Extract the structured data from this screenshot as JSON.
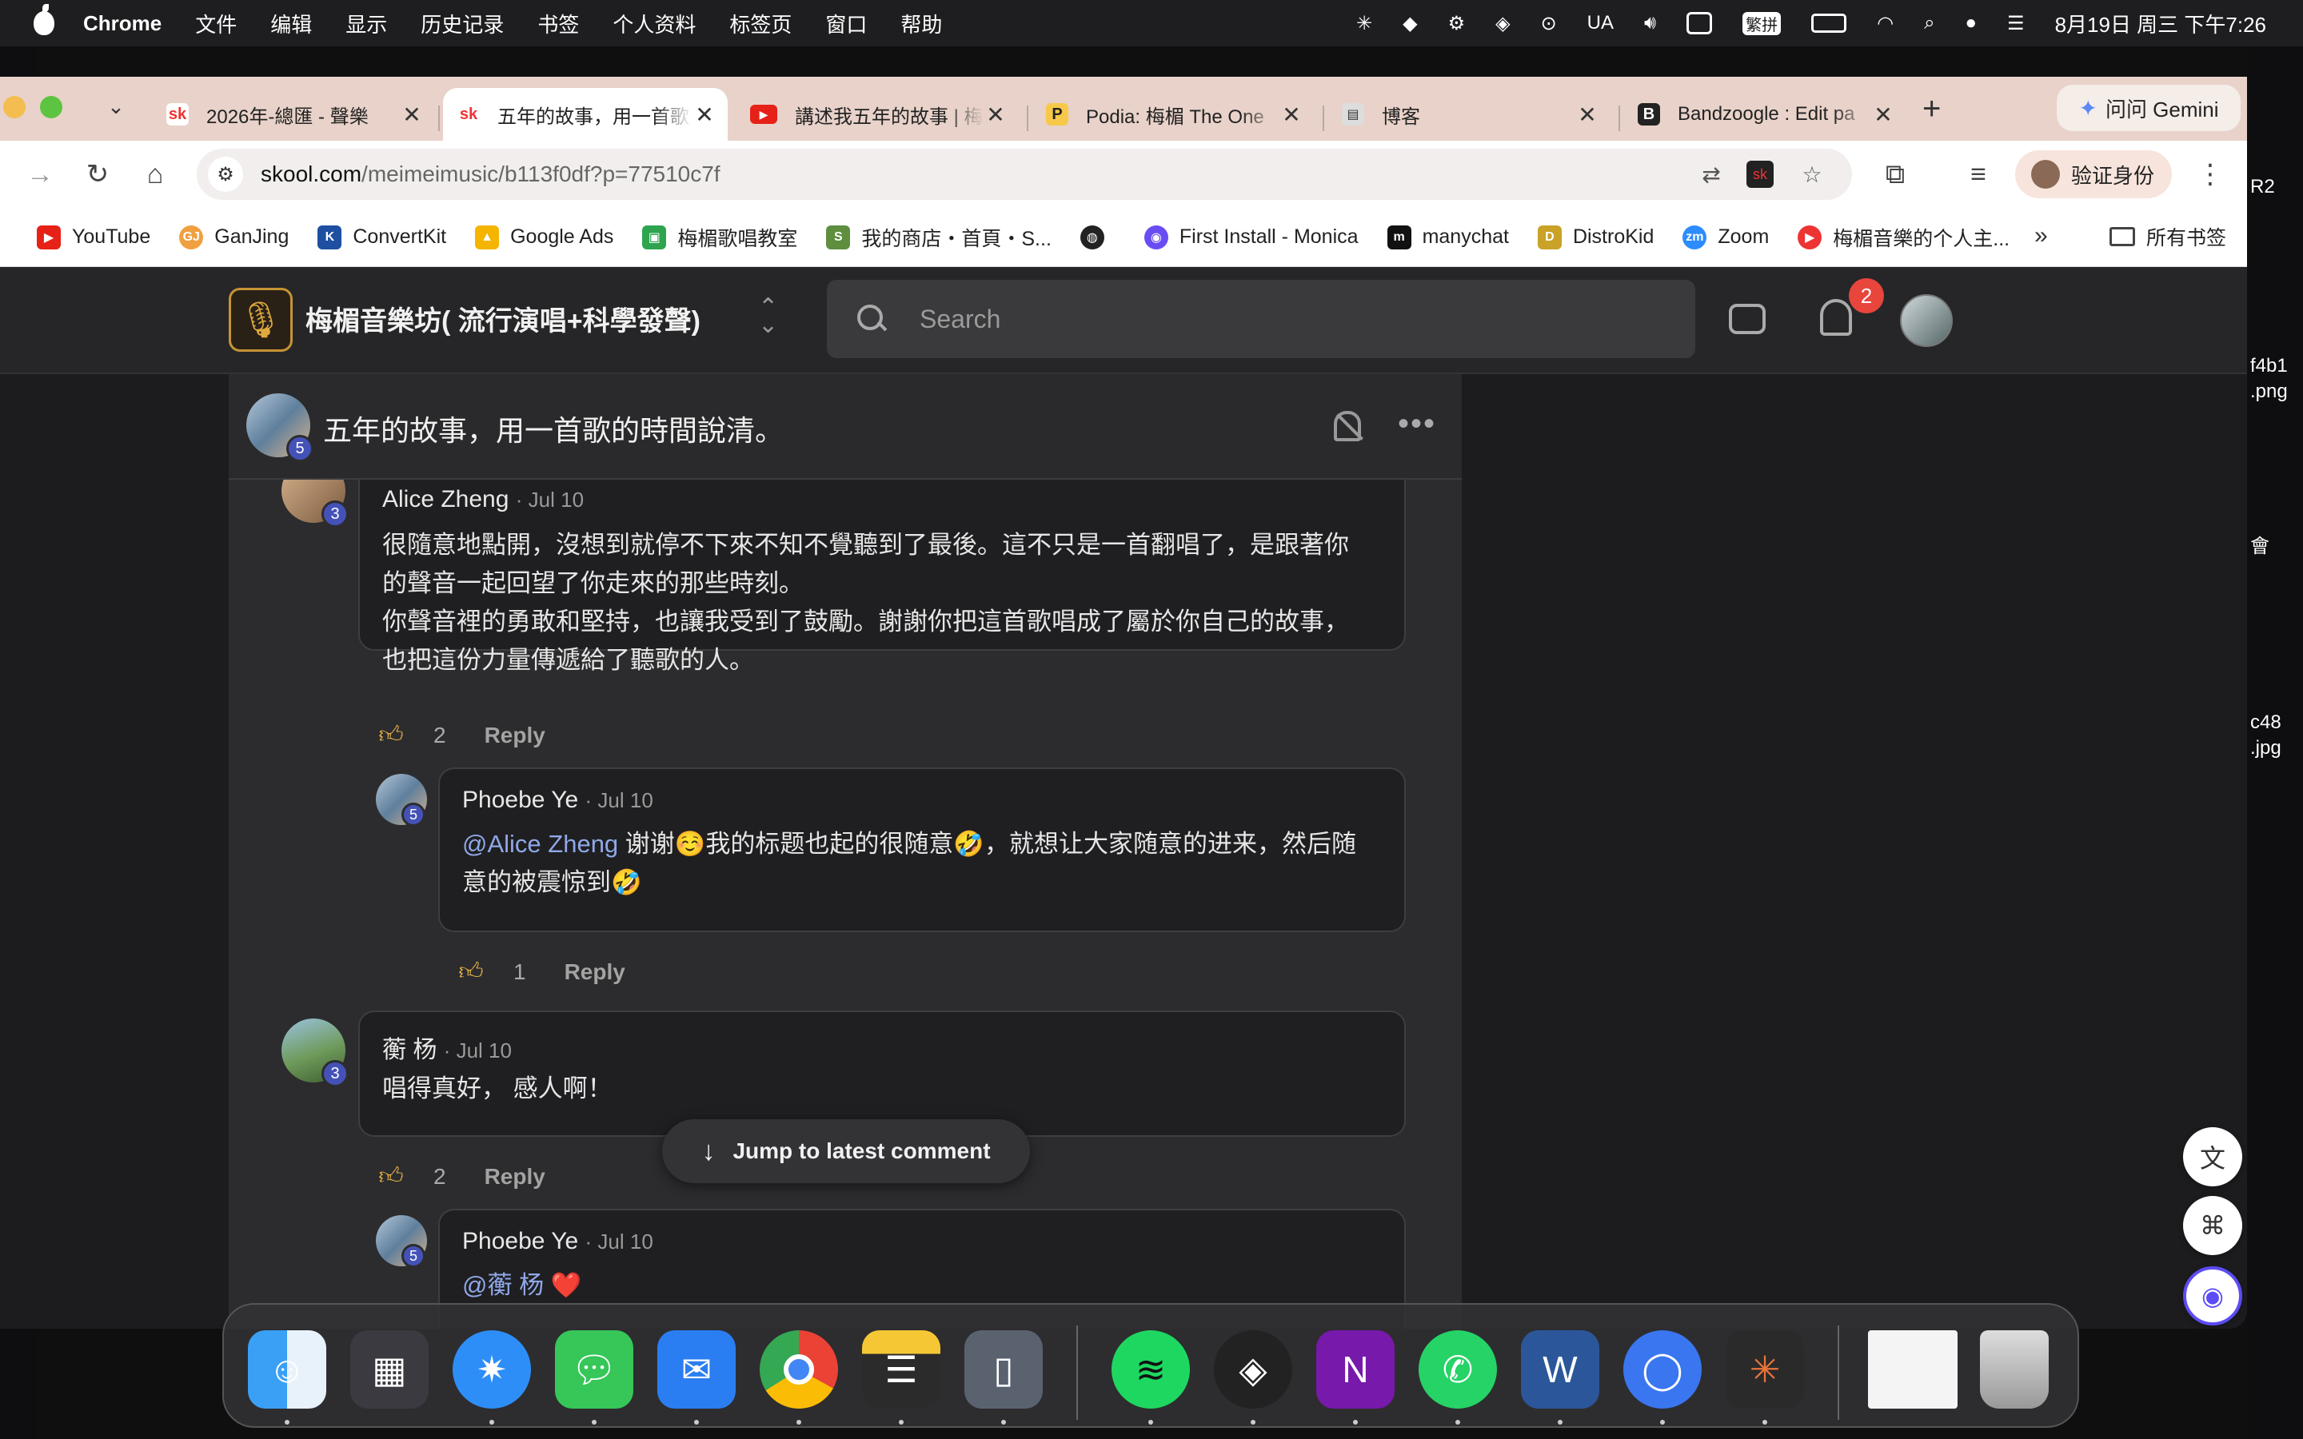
{
  "menubar": {
    "app": "Chrome",
    "items": [
      "文件",
      "编辑",
      "显示",
      "历史记录",
      "书签",
      "个人资料",
      "标签页",
      "窗口",
      "帮助"
    ],
    "status_ua": "UA",
    "status_ime": "繁拼",
    "clock": "8月19日 周三 下午7:26"
  },
  "desktop_right": {
    "f1": "R2",
    "f2a": "f4b1",
    "f2b": ".png",
    "f3": "會",
    "f4a": "c48",
    "f4b": ".jpg"
  },
  "tabs": [
    {
      "favicon": "sk",
      "title": "2026年-總匯 - 聲樂",
      "active": false
    },
    {
      "favicon": "sk",
      "title": "五年的故事，用一首歌",
      "active": true
    },
    {
      "favicon": "youtube",
      "title": "講述我五年的故事 | 梅",
      "active": false
    },
    {
      "favicon": "P",
      "title": "Podia: 梅楣 The One",
      "active": false
    },
    {
      "favicon": "blog",
      "title": "博客",
      "active": false
    },
    {
      "favicon": "B",
      "title": "Bandzoogle : Edit pa",
      "active": false
    }
  ],
  "gemini_label": "问问 Gemini",
  "url": {
    "host": "skool.com",
    "path": "/meimeimusic/b113f0df?p=77510c7f"
  },
  "verify_label": "验证身份",
  "bookmarks": [
    "YouTube",
    "GanJing",
    "ConvertKit",
    "Google Ads",
    "梅楣歌唱教室",
    "我的商店・首頁・S...",
    "",
    "First Install - Monica",
    "manychat",
    "DistroKid",
    "Zoom",
    "梅楣音樂的个人主..."
  ],
  "bookmarks_all": "所有书签",
  "group": {
    "name": "梅楣音樂坊( 流行演唱+科學發聲)"
  },
  "search": {
    "placeholder": "Search"
  },
  "notifications": {
    "count": "2"
  },
  "post": {
    "title": "五年的故事，用一首歌的時間說清。",
    "author_level": "5"
  },
  "comments": [
    {
      "author": "Alice Zheng",
      "date": "Jul 10",
      "level": "3",
      "lines": [
        "很隨意地點開，沒想到就停不下來不知不覺聽到了最後。這不只是一首翻唱了，是跟著你",
        "的聲音一起回望了你走來的那些時刻。",
        "你聲音裡的勇敢和堅持，也讓我受到了鼓勵。謝謝你把這首歌唱成了屬於你自己的故事，",
        "也把這份力量傳遞給了聽歌的人。"
      ],
      "likes": "2",
      "reply": "Reply"
    },
    {
      "author": "Phoebe Ye",
      "date": "Jul 10",
      "level": "5",
      "mention": "@Alice Zheng",
      "line1": " 谢谢☺️我的标题也起的很随意🤣，就想让大家随意的进来，然后随",
      "line2": "意的被震惊到🤣",
      "likes": "1",
      "reply": "Reply"
    },
    {
      "author": "蘅 杨",
      "date": "Jul 10",
      "level": "3",
      "text": "唱得真好， 感人啊！",
      "likes": "2",
      "reply": "Reply"
    },
    {
      "author": "Phoebe Ye",
      "date": "Jul 10",
      "level": "5",
      "mention": "@蘅 杨",
      "text": " ❤️"
    }
  ],
  "jump_label": "Jump to latest comment",
  "dock": [
    "Finder",
    "Launchpad",
    "Safari",
    "Messages",
    "Mail",
    "Chrome",
    "Notes",
    "Simulator",
    "Spotify",
    "Universal Audio",
    "OneNote",
    "WhatsApp",
    "Word",
    "Signal",
    "Claude",
    "Recent File",
    "Trash"
  ],
  "colors": {
    "accent_gold": "#c69436",
    "badge_red": "#e8453c",
    "level_blue": "#4452b8",
    "mention": "#8fa8e8",
    "like": "#e7b14a"
  }
}
